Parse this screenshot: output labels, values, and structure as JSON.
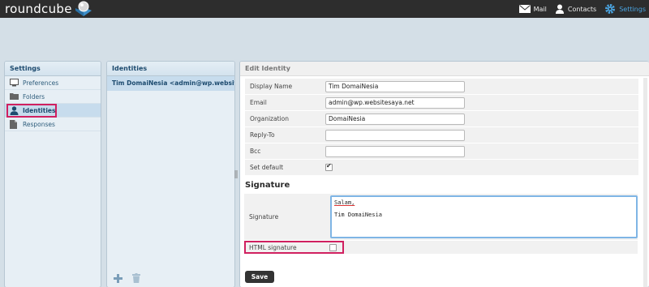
{
  "app": {
    "logo_text": "roundcube"
  },
  "topnav": {
    "mail": {
      "label": "Mail",
      "icon": "envelope-icon"
    },
    "contacts": {
      "label": "Contacts",
      "icon": "person-icon"
    },
    "settings": {
      "label": "Settings",
      "icon": "gear-icon"
    }
  },
  "settings_panel": {
    "title": "Settings",
    "items": [
      {
        "label": "Preferences",
        "icon": "monitor-icon"
      },
      {
        "label": "Folders",
        "icon": "folder-icon"
      },
      {
        "label": "Identities",
        "icon": "person-icon",
        "selected": true
      },
      {
        "label": "Responses",
        "icon": "document-icon"
      }
    ]
  },
  "identities_panel": {
    "title": "Identities",
    "rows": [
      "Tim DomaiNesia <admin@wp.website..."
    ]
  },
  "edit_panel": {
    "title": "Edit Identity",
    "fields": {
      "display_name": {
        "label": "Display Name",
        "value": "Tim DomaiNesia"
      },
      "email": {
        "label": "Email",
        "value": "admin@wp.websitesaya.net"
      },
      "organization": {
        "label": "Organization",
        "value": "DomaiNesia"
      },
      "reply_to": {
        "label": "Reply-To",
        "value": ""
      },
      "bcc": {
        "label": "Bcc",
        "value": ""
      },
      "set_default": {
        "label": "Set default",
        "checked": true
      }
    },
    "signature_section": {
      "heading": "Signature",
      "label": "Signature",
      "line1": "Salam,",
      "line2": "Tim DomaiNesia",
      "html_label": "HTML signature",
      "html_checked": false
    },
    "save_label": "Save"
  },
  "colors": {
    "topbar": "#2d2d2d",
    "accent": "#4aa3df",
    "highlight": "#d02060"
  }
}
